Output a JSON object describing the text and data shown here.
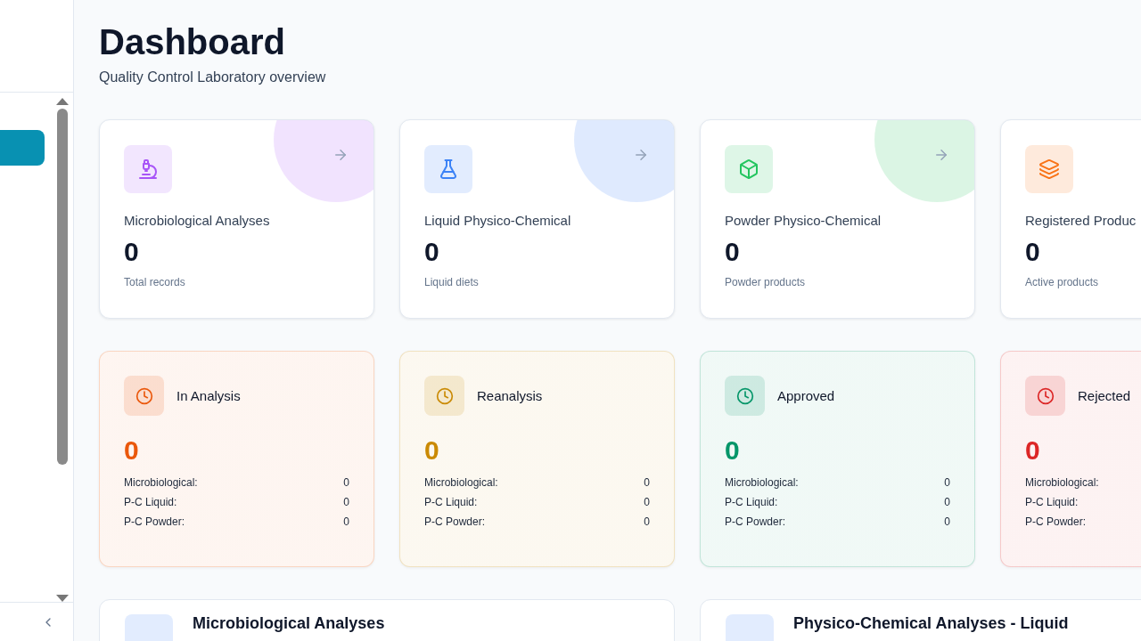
{
  "sidebar": {
    "nav_items": [
      {
        "selected": true
      }
    ]
  },
  "header": {
    "title": "Dashboard",
    "subtitle": "Quality Control Laboratory overview"
  },
  "summary_cards": [
    {
      "title": "Microbiological Analyses",
      "value": "0",
      "caption": "Total records",
      "color": "#a855f7"
    },
    {
      "title": "Liquid Physico-Chemical",
      "value": "0",
      "caption": "Liquid diets",
      "color": "#3b82f6"
    },
    {
      "title": "Powder Physico-Chemical",
      "value": "0",
      "caption": "Powder products",
      "color": "#22c55e"
    },
    {
      "title": "Registered Produc",
      "value": "0",
      "caption": "Active products",
      "color": "#f97316"
    }
  ],
  "status_cards": [
    {
      "title": "In Analysis",
      "value": "0",
      "color": "#ea580c",
      "rows": [
        {
          "label": "Microbiological:",
          "value": "0"
        },
        {
          "label": "P-C Liquid:",
          "value": "0"
        },
        {
          "label": "P-C Powder:",
          "value": "0"
        }
      ]
    },
    {
      "title": "Reanalysis",
      "value": "0",
      "color": "#ca8a04",
      "rows": [
        {
          "label": "Microbiological:",
          "value": "0"
        },
        {
          "label": "P-C Liquid:",
          "value": "0"
        },
        {
          "label": "P-C Powder:",
          "value": "0"
        }
      ]
    },
    {
      "title": "Approved",
      "value": "0",
      "color": "#059669",
      "rows": [
        {
          "label": "Microbiological:",
          "value": "0"
        },
        {
          "label": "P-C Liquid:",
          "value": "0"
        },
        {
          "label": "P-C Powder:",
          "value": "0"
        }
      ]
    },
    {
      "title": "Rejected",
      "value": "0",
      "color": "#dc2626",
      "rows": [
        {
          "label": "Microbiological:"
        },
        {
          "label": "P-C Liquid:"
        },
        {
          "label": "P-C Powder:"
        }
      ]
    }
  ],
  "section_cards": [
    {
      "title": "Microbiological Analyses"
    },
    {
      "title": "Physico-Chemical Analyses - Liquid"
    }
  ]
}
